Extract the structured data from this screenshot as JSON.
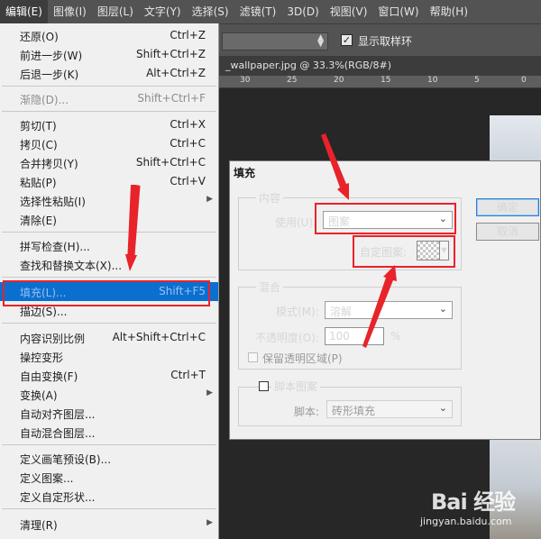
{
  "menubar": {
    "items": [
      "编辑(E)",
      "图像(I)",
      "图层(L)",
      "文字(Y)",
      "选择(S)",
      "滤镜(T)",
      "3D(D)",
      "视图(V)",
      "窗口(W)",
      "帮助(H)"
    ]
  },
  "options_bar": {
    "show_sampling_ring_label": "显示取样环",
    "show_sampling_ring_checked": true
  },
  "document": {
    "tab_title": "_wallpaper.jpg @ 33.3%(RGB/8#)",
    "ruler_labels": [
      "30",
      "25",
      "20",
      "15",
      "10",
      "5",
      "0"
    ]
  },
  "edit_menu": {
    "undo": {
      "label": "还原(O)",
      "shortcut": "Ctrl+Z"
    },
    "step_forward": {
      "label": "前进一步(W)",
      "shortcut": "Shift+Ctrl+Z"
    },
    "step_backward": {
      "label": "后退一步(K)",
      "shortcut": "Alt+Ctrl+Z"
    },
    "fade": {
      "label": "渐隐(D)...",
      "shortcut": "Shift+Ctrl+F"
    },
    "cut": {
      "label": "剪切(T)",
      "shortcut": "Ctrl+X"
    },
    "copy": {
      "label": "拷贝(C)",
      "shortcut": "Ctrl+C"
    },
    "copy_merged": {
      "label": "合并拷贝(Y)",
      "shortcut": "Shift+Ctrl+C"
    },
    "paste": {
      "label": "粘贴(P)",
      "shortcut": "Ctrl+V"
    },
    "paste_special": {
      "label": "选择性粘贴(I)"
    },
    "clear": {
      "label": "清除(E)"
    },
    "spell_check": {
      "label": "拼写检查(H)..."
    },
    "find_replace": {
      "label": "查找和替换文本(X)..."
    },
    "fill": {
      "label": "填充(L)...",
      "shortcut": "Shift+F5"
    },
    "stroke": {
      "label": "描边(S)..."
    },
    "content_aware_scale": {
      "label": "内容识别比例",
      "shortcut": "Alt+Shift+Ctrl+C"
    },
    "puppet_warp": {
      "label": "操控变形"
    },
    "free_transform": {
      "label": "自由变换(F)",
      "shortcut": "Ctrl+T"
    },
    "transform": {
      "label": "变换(A)"
    },
    "auto_align": {
      "label": "自动对齐图层..."
    },
    "auto_blend": {
      "label": "自动混合图层..."
    },
    "define_brush": {
      "label": "定义画笔预设(B)..."
    },
    "define_pattern": {
      "label": "定义图案..."
    },
    "define_shape": {
      "label": "定义自定形状..."
    },
    "purge": {
      "label": "清理(R)"
    }
  },
  "fill_dialog": {
    "title": "填充",
    "contents_group": "内容",
    "use_label": "使用(U):",
    "use_value": "图案",
    "custom_pattern_label": "自定图案:",
    "blending_group": "混合",
    "mode_label": "模式(M):",
    "mode_value": "溶解",
    "opacity_label": "不透明度(O):",
    "opacity_value": "100",
    "opacity_unit": "%",
    "preserve_transparency_label": "保留透明区域(P)",
    "script_label": "脚本图案",
    "script_field_label": "脚本:",
    "script_value": "砖形填充",
    "ok_label": "确定",
    "cancel_label": "取消"
  },
  "watermark": {
    "brand": "Bai 经验",
    "url": "jingyan.baidu.com"
  },
  "colors": {
    "menu_highlight": "#0b6fd0",
    "annotation_red": "#e8232a"
  }
}
